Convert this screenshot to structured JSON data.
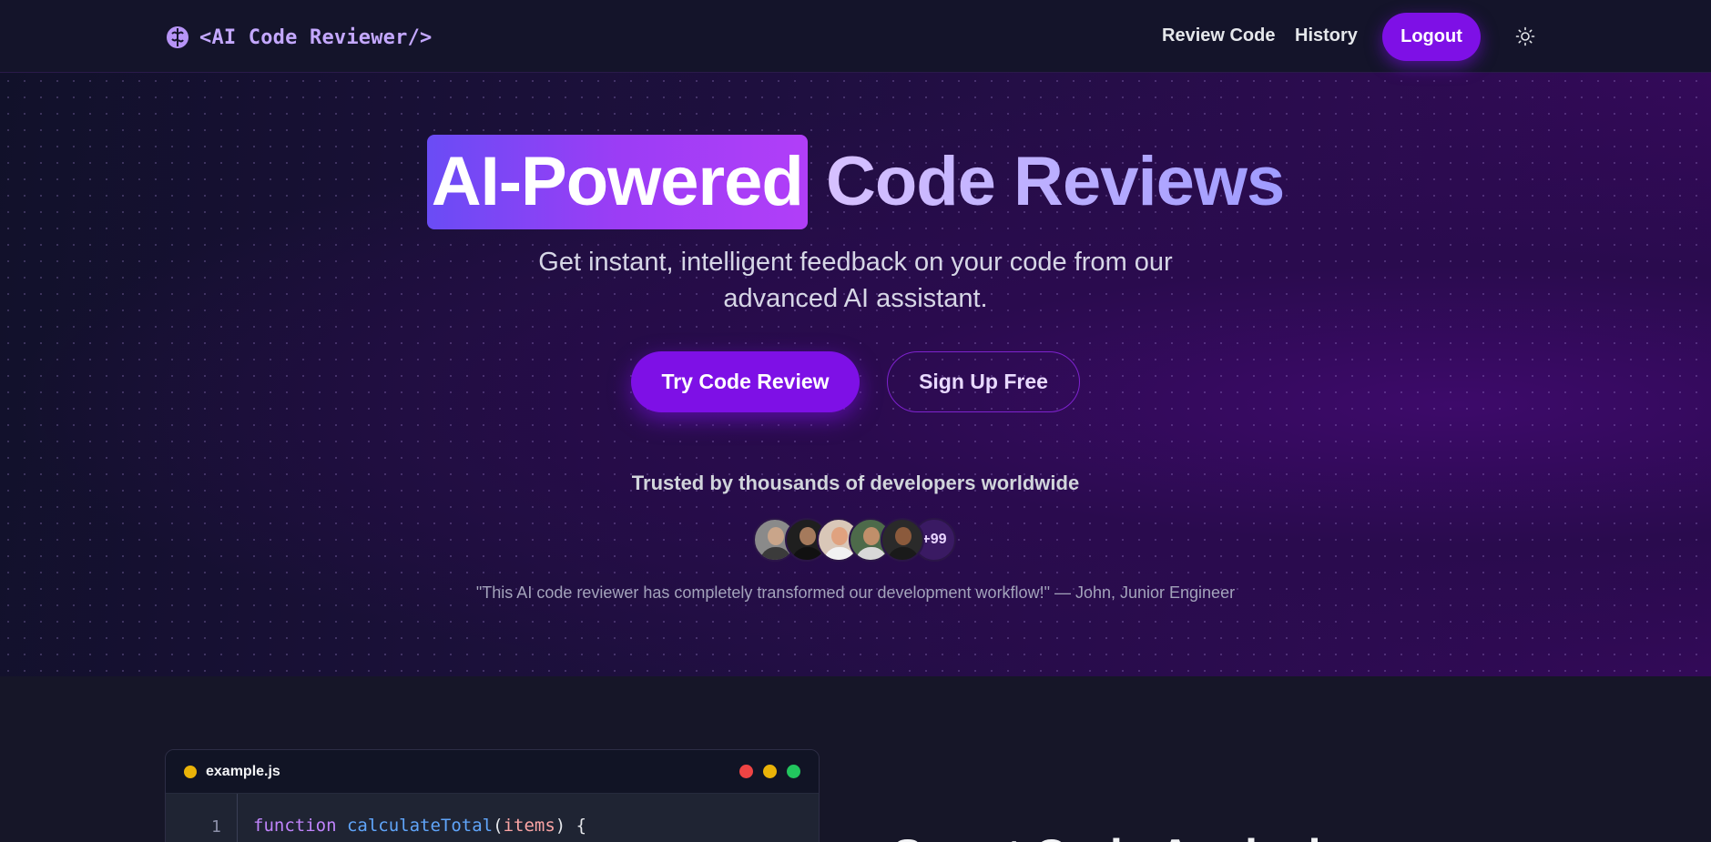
{
  "navbar": {
    "brand_text": "<AI Code Reviewer/>",
    "brand_icon": "brain-icon",
    "links": [
      {
        "label": "Review Code"
      },
      {
        "label": "History"
      }
    ],
    "logout_label": "Logout",
    "theme_icon": "sun-icon"
  },
  "hero": {
    "title_highlight": "AI-Powered",
    "title_rest": " Code Reviews",
    "subtitle": "Get instant, intelligent feedback on your code from our advanced AI assistant.",
    "primary_cta": "Try Code Review",
    "secondary_cta": "Sign Up Free",
    "trusted_text": "Trusted by thousands of developers worldwide",
    "avatar_count": "+99",
    "testimonial": "\"This AI code reviewer has completely transformed our development workflow!\" — John, Junior Engineer"
  },
  "code_sample": {
    "file_name": "example.js",
    "line_number": "1",
    "tokens": {
      "keyword": "function",
      "fn_name": "calculateTotal",
      "open_paren": "(",
      "param": "items",
      "close": ") {"
    }
  },
  "feature": {
    "heading": "Smart Code Analysis"
  },
  "colors": {
    "accent": "#7e10e6",
    "brand_text": "#c4a8ff",
    "background": "#151528"
  }
}
